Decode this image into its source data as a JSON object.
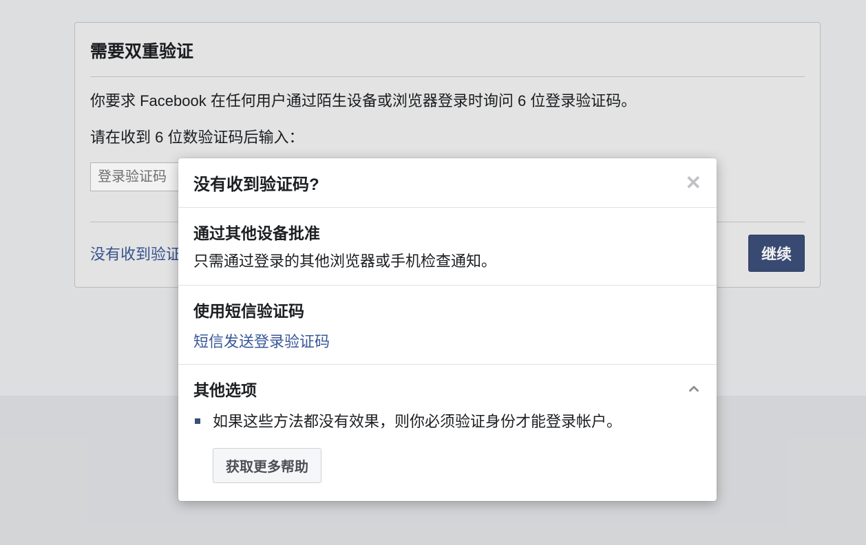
{
  "card": {
    "title": "需要双重验证",
    "description": "你要求 Facebook 在任何用户通过陌生设备或浏览器登录时询问 6 位登录验证码。",
    "prompt": "请在收到 6 位数验证码后输入：",
    "input_placeholder": "登录验证码",
    "footer_link": "没有收到验证码?",
    "continue_label": "继续"
  },
  "modal": {
    "title": "没有收到验证码?",
    "sections": {
      "approve": {
        "title": "通过其他设备批准",
        "desc": "只需通过登录的其他浏览器或手机检查通知。"
      },
      "sms": {
        "title": "使用短信验证码",
        "link": "短信发送登录验证码"
      },
      "other": {
        "title": "其他选项",
        "bullet": "如果这些方法都没有效果，则你必须验证身份才能登录帐户。",
        "help_button": "获取更多帮助"
      }
    }
  }
}
